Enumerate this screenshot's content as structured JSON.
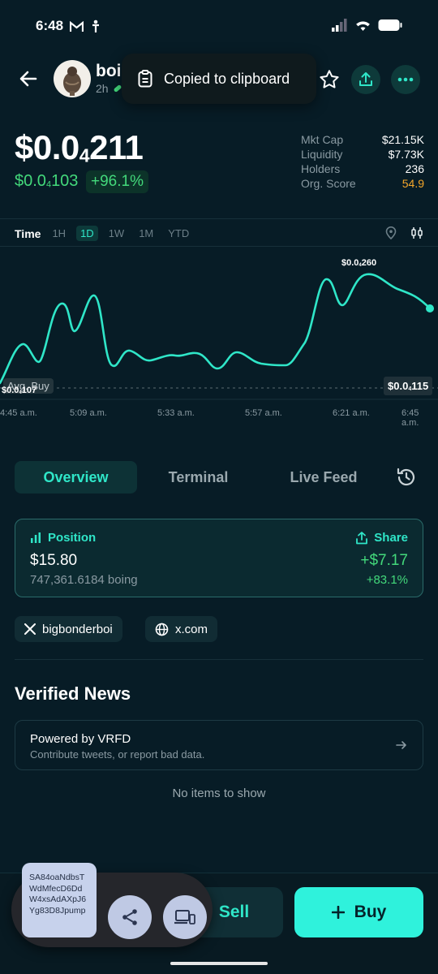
{
  "status_bar": {
    "time": "6:48"
  },
  "header": {
    "token_name": "boi",
    "age": "2h",
    "toast": "Copied to clipboard"
  },
  "price": {
    "main_prefix": "$0.0",
    "main_sub": "4",
    "main_suffix": "211",
    "base_prefix": "$0.0",
    "base_sub": "4",
    "base_suffix": "103",
    "change": "+96.1%"
  },
  "stats": [
    {
      "label": "Mkt Cap",
      "value": "$21.15K"
    },
    {
      "label": "Liquidity",
      "value": "$7.73K"
    },
    {
      "label": "Holders",
      "value": "236"
    },
    {
      "label": "Org. Score",
      "value": "54.9"
    }
  ],
  "timeframe": {
    "label": "Time",
    "options": [
      "1H",
      "1D",
      "1W",
      "1M",
      "YTD"
    ],
    "active": "1D"
  },
  "chart": {
    "high_prefix": "$0.0",
    "high_sub": "4",
    "high_suffix": "260",
    "low_prefix": "$0.0",
    "low_sub": "4",
    "low_suffix": "107",
    "last_prefix": "$0.0",
    "last_sub": "4",
    "last_suffix": "115",
    "avg_buy_label": "Avg. Buy",
    "x_ticks": [
      "4:45 a.m.",
      "5:09 a.m.",
      "5:33 a.m.",
      "5:57 a.m.",
      "6:21 a.m.",
      "6:45 a.m."
    ],
    "line_color": "#2fe6c8"
  },
  "tabs": [
    "Overview",
    "Terminal",
    "Live Feed"
  ],
  "position": {
    "title": "Position",
    "share_label": "Share",
    "value": "$15.80",
    "quantity": "747,361.6184 boing",
    "gain": "+$7.17",
    "gain_pct": "+83.1%"
  },
  "links": [
    {
      "icon": "x-logo-icon",
      "label": "bigbonderboi"
    },
    {
      "icon": "globe-icon",
      "label": "x.com"
    }
  ],
  "news": {
    "title": "Verified News",
    "card_title": "Powered by VRFD",
    "card_subtitle": "Contribute tweets, or report bad data.",
    "empty": "No items to show"
  },
  "actions": {
    "sell": "Sell",
    "buy": "Buy"
  },
  "clipboard_preview": "SA84oaNdbsTWdMfecD6DdW4xsAdAXpJ6Yg83D8Jpump",
  "colors": {
    "accent": "#2fe6c8",
    "positive": "#43d97b",
    "warning": "#f4a62a",
    "background": "#071c26"
  }
}
